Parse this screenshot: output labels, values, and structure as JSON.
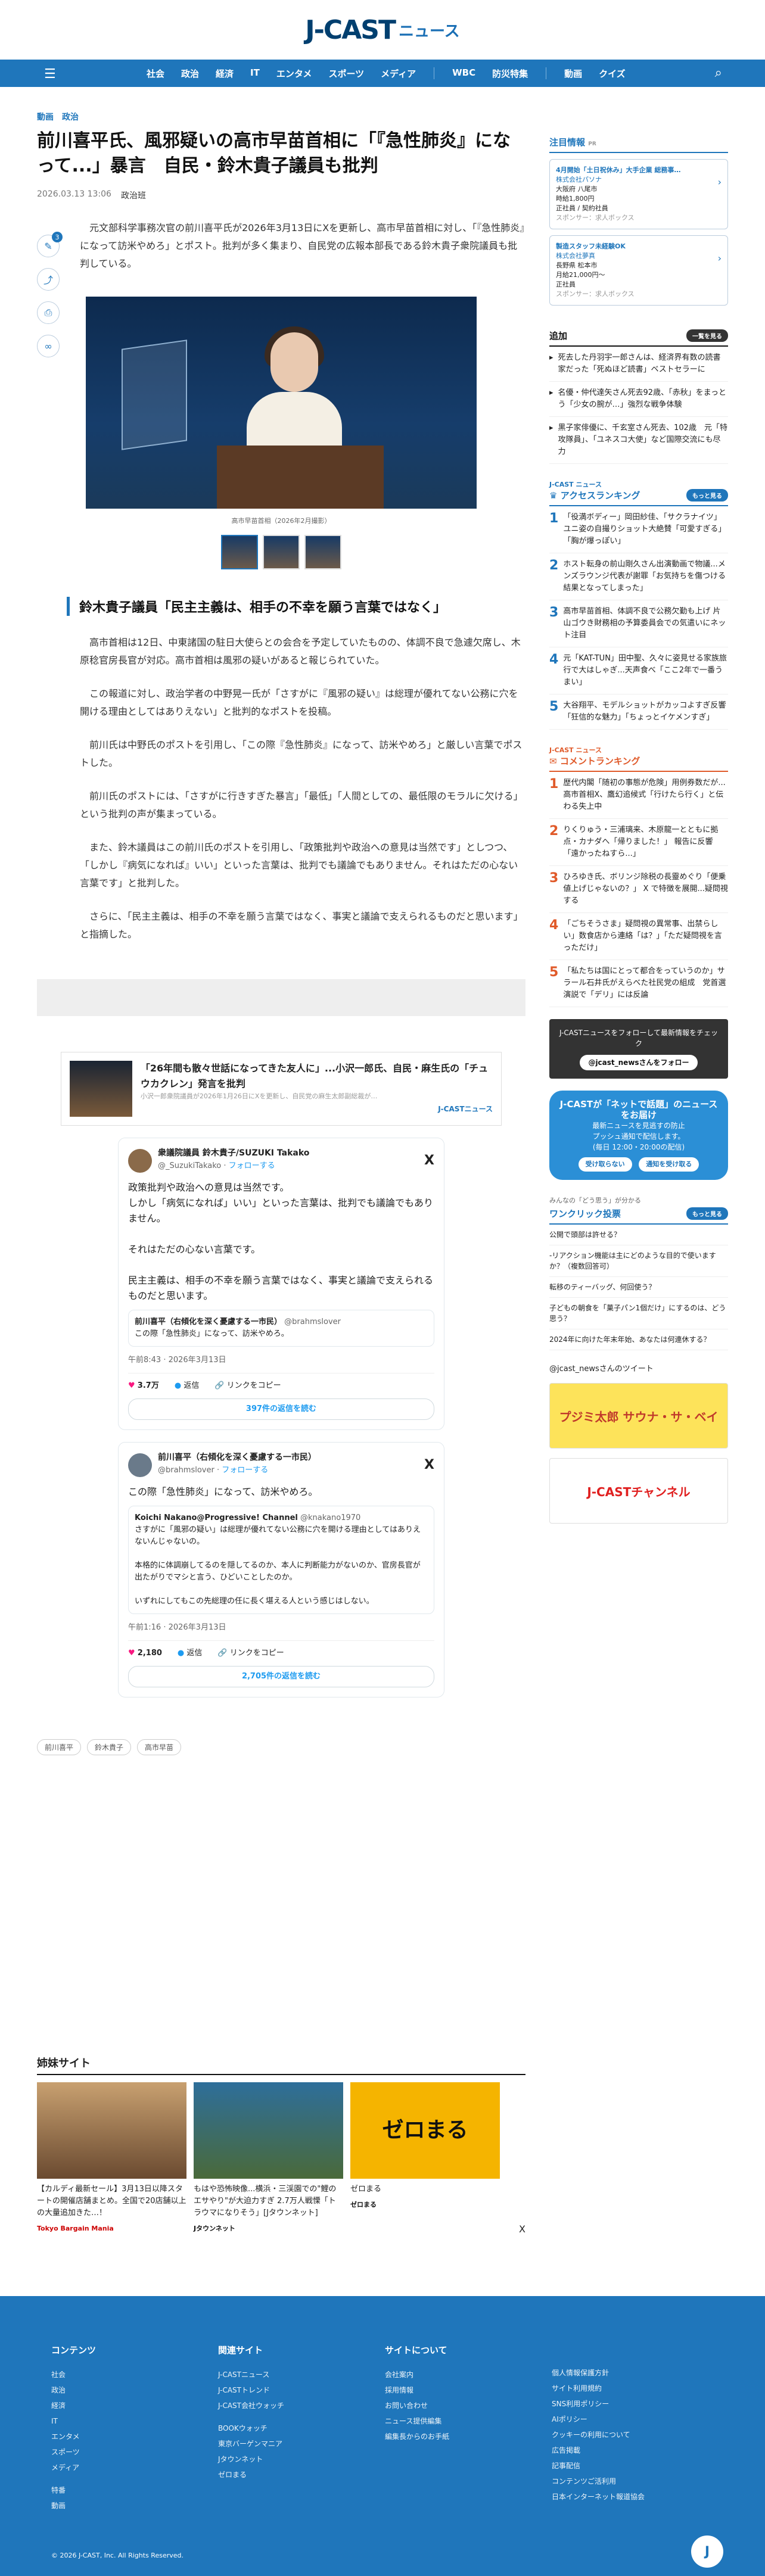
{
  "header": {
    "logo_mark": "J-CAST",
    "logo_text": "ニュース"
  },
  "nav": {
    "menu_icon": "☰",
    "items": [
      "社会",
      "政治",
      "経済",
      "IT",
      "エンタメ",
      "スポーツ",
      "メディア"
    ],
    "extra": [
      "WBC",
      "防災特集"
    ],
    "tail": [
      "動画",
      "クイズ"
    ],
    "search_icon": "⌕"
  },
  "article": {
    "cats": [
      "動画",
      "政治"
    ],
    "title": "前川喜平氏、風邪疑いの高市早苗首相に「『急性肺炎』になって...」暴言　自民・鈴木貴子議員も批判",
    "date": "2026.03.13 13:06",
    "author": "政治班",
    "share_count": "3",
    "lead": "元文部科学事務次官の前川喜平氏が2026年3月13日にXを更新し、高市早苗首相に対し、「『急性肺炎』になって訪米やめろ」とポスト。批判が多く集まり、自民党の広報本部長である鈴木貴子衆院議員も批判している。",
    "caption": "高市早苗首相（2026年2月撮影）",
    "h2": "鈴木貴子議員「民主主義は、相手の不幸を願う言葉ではなく」",
    "paras": [
      "高市首相は12日、中東諸国の駐日大使らとの会合を予定していたものの、体調不良で急遽欠席し、木原稔官房長官が対応。高市首相は風邪の疑いがあると報じられていた。",
      "この報道に対し、政治学者の中野晃一氏が「さすがに『風邪の疑い』は総理が優れてない公務に穴を開ける理由としてはありえない」と批判的なポストを投稿。",
      "前川氏は中野氏のポストを引用し、「この際『急性肺炎』になって、訪米やめろ」と厳しい言葉でポストした。",
      "前川氏のポストには、「さすがに行きすぎた暴言」「最低」「人間としての、最低限のモラルに欠ける」という批判の声が集まっている。",
      "また、鈴木議員はこの前川氏のポストを引用し、「政策批判や政治への意見は当然です」としつつ、「しかし『病気になれば』いい」といった言葉は、批判でも議論でもありません。それはただの心ない言葉です」と批判した。",
      "さらに、「民主主義は、相手の不幸を願う言葉ではなく、事実と議論で支えられるものだと思います」と指摘した。"
    ],
    "related": {
      "title": "「26年間も散々世話になってきた友人に」...小沢一郎氏、自民・麻生氏の「チュウカクレン」発言を批判",
      "snippet": "小沢一郎衆院議員が2026年1月26日にXを更新し、自民党の麻生太郎副総裁が…",
      "source": "J-CASTニュース"
    },
    "tags": [
      "前川喜平",
      "鈴木貴子",
      "高市早苗"
    ]
  },
  "tweets": [
    {
      "name": "衆議院議員 鈴木貴子/SUZUKI Takako",
      "handle": "@_SuzukiTakako",
      "follow": "フォローする",
      "text": "政策批判や政治への意見は当然です。\nしかし「病気になれば」いい」といった言葉は、批判でも議論でもありません。\n\nそれはただの心ない言葉です。\n\n民主主義は、相手の不幸を願う言葉ではなく、事実と議論で支えられるものだと思います。",
      "quote_name": "前川喜平（右傾化を深く憂慮する一市民）",
      "quote_handle": "@brahmslover",
      "quote_text": "この際「急性肺炎」になって、訪米やめろ。",
      "time": "午前8:43 · 2026年3月13日",
      "likes": "3.7万",
      "reply": "返信",
      "copy": "リンクをコピー",
      "more": "397件の返信を読む"
    },
    {
      "name": "前川喜平（右傾化を深く憂慮する一市民）",
      "handle": "@brahmslover",
      "follow": "フォローする",
      "text": "この際「急性肺炎」になって、訪米やめろ。",
      "quote_name": "Koichi Nakano@Progressive! Channel",
      "quote_handle": "@knakano1970",
      "quote_text": "さすがに「風邪の疑い」は総理が優れてない公務に穴を開ける理由としてはありえないんじゃないの。\n\n本格的に体調崩してるのを隠してるのか、本人に判断能力がないのか、官房長官が出たがりでマシと言う、ひどいことしたのか。\n\nいずれにしてもこの先総理の任に長く堪える人という感じはしない。",
      "time": "午前1:16 · 2026年3月13日",
      "likes": "2,180",
      "reply": "返信",
      "copy": "リンクをコピー",
      "more": "2,705件の返信を読む"
    }
  ],
  "sister": {
    "title": "姉妹サイト",
    "items": [
      {
        "text": "【カルディ最新セール】3月13日以降スタートの開催店舗まとめ。全国で20店舗以上の大量追加きた…！",
        "brand": "Tokyo Bargain Mania"
      },
      {
        "text": "もはや恐怖映像...横浜・三渓園での\"鯉のエサやり\"が大迫力すぎ 2.7万人戦慄「トラウマになりそう」[Jタウンネット]",
        "brand": "Jタウンネット"
      },
      {
        "text": "ゼロまる",
        "brand": "ゼロまる"
      }
    ],
    "close": "X"
  },
  "side": {
    "notice": "注目情報",
    "pr": "PR",
    "ads": [
      {
        "h": "4月開始「土日祝休み」大手企業 総務事…",
        "co": "株式会社パソナ",
        "l1": "大阪府 八尾市",
        "l2": "時給1,800円",
        "l3": "正社員 / 契約社員",
        "sp": "スポンサー：求人ボックス"
      },
      {
        "h": "製造スタッフ未経験OK",
        "co": "株式会社夢真",
        "l1": "長野県 松本市",
        "l2": "月給21,000円～",
        "l3": "正社員",
        "sp": "スポンサー：求人ボックス"
      }
    ],
    "follow_title": "追加",
    "follow_btn": "一覧を見る",
    "news": [
      "死去した丹羽宇一郎さんは、経済界有数の読書家だった「死ぬほど読書」ベストセラーに",
      "名優・仲代達矢さん死去92歳、「赤秋」をまっとう「少女の腕が…」強烈な戦争体験",
      "黒子家俳優に、千玄室さん死去、102歳　元「特攻隊員」、「ユネスコ大使」など国際交流にも尽力"
    ],
    "brand_tag": "J-CAST ニュース",
    "ranking_title": "アクセスランキング",
    "more": "もっと見る",
    "ranking": [
      "「役満ボディー」岡田紗佳、「サクラナイツ」ユニ姿の自撮りショット大絶賛「可愛すぎる」「胸が爆っぽい」",
      "ホスト転身の前山剛久さん出演動画で物議...メンズラウンジ代表が謝罪「お気持ちを傷つける結果となってしまった」",
      "高市早苗首相、体調不良で公務欠勤も上げ 片山ゴウき財務相の予算委員会での気遣いにネット注目",
      "元「KAT-TUN」田中聖、久々に姿見せる家族旅行で大はしゃぎ...天声食べ「ここ2年で一番うまい」",
      "大谷翔平、モデルショットがカッコよすぎ反響「狂信的な魅力」「ちょっとイケメンすぎ」"
    ],
    "comment_title": "コメントランキング",
    "comments": [
      "歴代内閣「随初の事態が危険」用例券数だが...高市首相X、鷹幻追候式「行けたら行く」と伝わる失上中",
      "りくりゅう・三浦璃来、木原龍一とともに拠点・カナダへ「帰りました！」 報告に反響「遠かったねすら...」",
      "ひろゆき氏、ボリンジ除税の長靈めぐり「便乗値上げじゃないの？」 X で特徴を展開...疑問視する",
      "「ごちそうさま」疑問視の異常事、出禁らしい」数食店から連絡「は？」「ただ疑問視を言っただけ」",
      "「私たちは国にとって都合をっていうのか」サラール石井氏がえらべた社民党の組成　党首選演説で「デリ」には反論"
    ],
    "xfollow": "J-CASTニュースをフォローして最新情報をチェック",
    "xbtn": "@jcast_newsさんをフォロー",
    "push_t": "J-CASTが「ネットで話題」のニュースをお届け",
    "push_s": "最新ニュースを見逃すの防止",
    "push_n": "プッシュ通知で配信します。",
    "push_time": "(毎日 12:00・20:00の配信)",
    "push_yes": "受け取らない",
    "push_no": "通知を受け取る",
    "vote_tag": "みんなの「どう思う」が分かる",
    "vote_title": "ワンクリック投票",
    "votes": [
      "公開で頭部は許せる？",
      "-リアクション機能は主にどのような目的で使いますか？（複数回答可）",
      "転移のティーバッグ、何回使う？",
      "子どもの朝食を「菓子パン1個だけ」にするのは、どう思う？",
      "2024年に向けた年末年始、あなたは何連休する？"
    ],
    "tweets_label": "@jcast_newsさんのツイート",
    "banner1": "プジミ太郎 サウナ・サ・ベイ",
    "banner2": "J-CASTチャンネル"
  },
  "footer": {
    "cols": [
      {
        "h": "コンテンツ",
        "items": [
          "社会",
          "政治",
          "経済",
          "IT",
          "エンタメ",
          "スポーツ",
          "メディア",
          "",
          "特番",
          "動画"
        ]
      },
      {
        "h": "関連サイト",
        "items": [
          "J-CASTニュース",
          "J-CASTトレンド",
          "J-CAST会社ウォッチ",
          "",
          "BOOKウォッチ",
          "東京バーゲンマニア",
          "Jタウンネット",
          "ゼロまる"
        ]
      },
      {
        "h": "サイトについて",
        "items": [
          "会社案内",
          "採用情報",
          "お問い合わせ",
          "ニュース提供編集",
          "編集長からのお手紙"
        ]
      },
      {
        "h": "",
        "items": [
          "個人情報保護方針",
          "サイト利用規約",
          "SNS利用ポリシー",
          "AIポリシー",
          "クッキーの利用について",
          "広告掲載",
          "記事配信",
          "コンテンツご活利用",
          "日本インターネット報道協会"
        ]
      }
    ],
    "copyright": "© 2026 J-CAST, Inc. All Rights Reserved.",
    "mark": "J"
  }
}
